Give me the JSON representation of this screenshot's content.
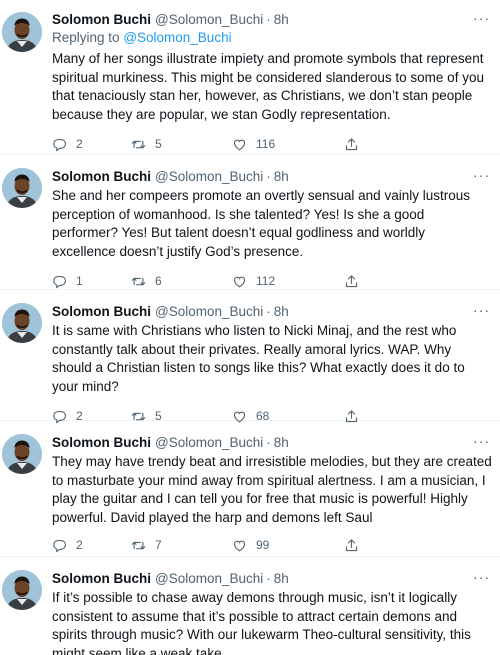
{
  "tweets": [
    {
      "name": "Solomon Buchi",
      "handle": "@Solomon_Buchi",
      "time": "8h",
      "replying_prefix": "Replying to",
      "replying_to": "@Solomon_Buchi",
      "text": "Many of her songs illustrate impiety and promote symbols that represent spiritual murkiness. This might be considered slanderous to some of you that tenaciously stan her, however, as Christians, we don’t stan people because they are popular, we stan Godly representation.",
      "replies": "2",
      "retweets": "5",
      "likes": "116"
    },
    {
      "name": "Solomon Buchi",
      "handle": "@Solomon_Buchi",
      "time": "8h",
      "text": "She and her compeers promote an overtly sensual and vainly lustrous perception of womanhood. Is she talented? Yes! Is she a good performer? Yes! But talent doesn’t equal godliness and worldly excellence doesn’t justify God’s presence.",
      "replies": "1",
      "retweets": "6",
      "likes": "112"
    },
    {
      "name": "Solomon Buchi",
      "handle": "@Solomon_Buchi",
      "time": "8h",
      "text": "It is same with Christians who listen to Nicki Minaj, and the rest who constantly talk about their privates. Really amoral lyrics. WAP. Why should a Christian listen to songs like this? What exactly does it do to your mind?",
      "replies": "2",
      "retweets": "5",
      "likes": "68"
    },
    {
      "name": "Solomon Buchi",
      "handle": "@Solomon_Buchi",
      "time": "8h",
      "text": "They may have trendy beat and irresistible melodies, but they are created to masturbate your mind away from spiritual alertness. I am a musician, I play the guitar and I can tell you for free that music is powerful! Highly powerful. David played the harp and demons left Saul",
      "replies": "2",
      "retweets": "7",
      "likes": "99"
    },
    {
      "name": "Solomon Buchi",
      "handle": "@Solomon_Buchi",
      "time": "8h",
      "text": "If it’s possible to chase away demons through music, isn’t it logically consistent to assume that it’s possible to attract certain demons and spirits through music? With our lukewarm Theo-cultural sensitivity, this might seem like a weak take."
    }
  ],
  "more_glyph": "···",
  "dot_sep": "·",
  "colors": {
    "text": "#0f1419",
    "muted": "#536471",
    "link": "#1d9bf0",
    "divider": "#eff3f4"
  }
}
